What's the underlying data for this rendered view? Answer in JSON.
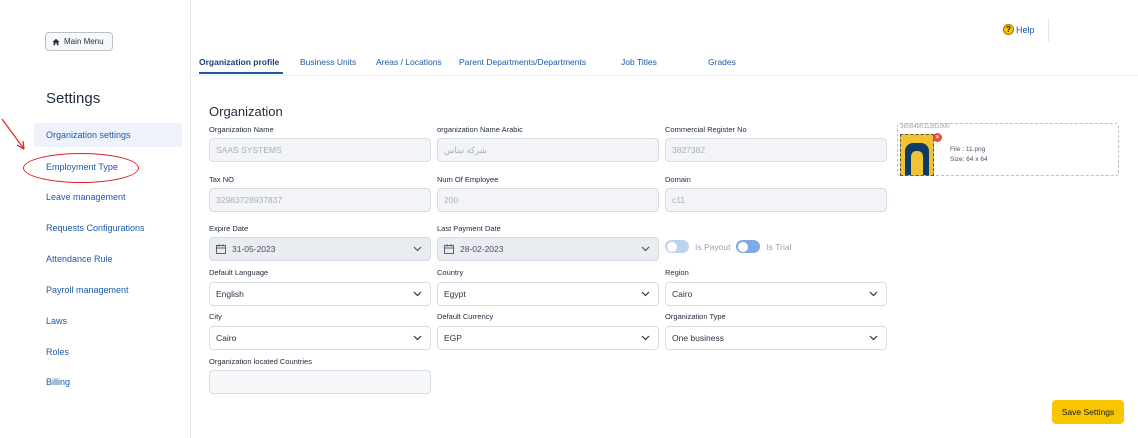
{
  "sidebar": {
    "main_menu": "Main Menu",
    "title": "Settings",
    "items": [
      {
        "label": "Organization settings"
      },
      {
        "label": "Employment Type"
      },
      {
        "label": "Leave management"
      },
      {
        "label": "Requests Configurations"
      },
      {
        "label": "Attendance Rule"
      },
      {
        "label": "Payroll management"
      },
      {
        "label": "Laws"
      },
      {
        "label": "Roles"
      },
      {
        "label": "Billing"
      }
    ]
  },
  "header": {
    "help": "Help"
  },
  "tabs": [
    {
      "label": "Organization profile"
    },
    {
      "label": "Business Units"
    },
    {
      "label": "Areas / Locations"
    },
    {
      "label": "Parent Departments/Departments"
    },
    {
      "label": "Job Titles"
    },
    {
      "label": "Grades"
    }
  ],
  "form": {
    "title": "Organization",
    "org_name": {
      "label": "Organization Name",
      "value": "SAAS SYSTEMS"
    },
    "org_name_ar": {
      "label": "organization Name Arabic",
      "value": "شركة ساس"
    },
    "commercial": {
      "label": "Commercial Register No",
      "value": "3827382"
    },
    "tax": {
      "label": "Tax NO",
      "value": "32983728937837"
    },
    "num_emp": {
      "label": "Num Of Employee",
      "value": "200"
    },
    "domain": {
      "label": "Domain",
      "value": "c11"
    },
    "expire": {
      "label": "Expire Date",
      "value": "31-05-2023"
    },
    "last_payment": {
      "label": "Last Payment Date",
      "value": "28-02-2023"
    },
    "is_payout": "Is Payout",
    "is_trial": "Is Trial",
    "language": {
      "label": "Default Language",
      "value": "English"
    },
    "country": {
      "label": "Country",
      "value": "Egypt"
    },
    "region": {
      "label": "Region",
      "value": "Cairo"
    },
    "city": {
      "label": "City",
      "value": "Cairo"
    },
    "currency": {
      "label": "Default Currency",
      "value": "EGP"
    },
    "org_type": {
      "label": "Organization Type",
      "value": "One business"
    },
    "located": {
      "label": "Organization located Countries",
      "value": ""
    }
  },
  "upload": {
    "id": "360848011391000",
    "file": "File : 11.png",
    "size": "Size: 64 x 64"
  },
  "save": "Save Settings",
  "colors": {
    "accent": "#1d5aa6",
    "save": "#f7c600",
    "annotation": "#e02020"
  }
}
